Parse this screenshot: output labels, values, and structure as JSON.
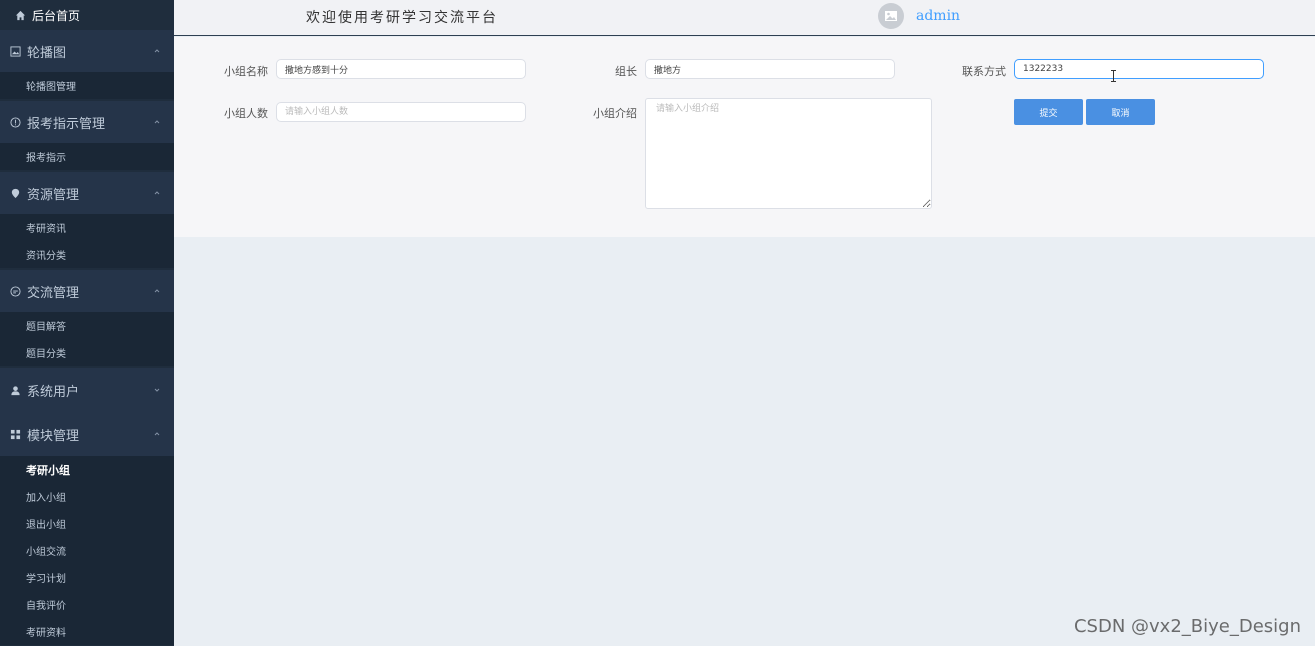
{
  "sidebar": {
    "home_label": "后台首页",
    "groups": [
      {
        "title": "轮播图",
        "icon": "image-icon",
        "expanded": true,
        "items": [
          "轮播图管理"
        ]
      },
      {
        "title": "报考指示管理",
        "icon": "info-icon",
        "expanded": true,
        "items": [
          "报考指示"
        ]
      },
      {
        "title": "资源管理",
        "icon": "location-pin-icon",
        "expanded": true,
        "items": [
          "考研资讯",
          "资讯分类"
        ]
      },
      {
        "title": "交流管理",
        "icon": "chat-icon",
        "expanded": true,
        "items": [
          "题目解答",
          "题目分类"
        ]
      },
      {
        "title": "系统用户",
        "icon": "user-icon",
        "expanded": false,
        "items": []
      },
      {
        "title": "模块管理",
        "icon": "grid-icon",
        "expanded": true,
        "items": [
          "考研小组",
          "加入小组",
          "退出小组",
          "小组交流",
          "学习计划",
          "自我评价",
          "考研资料"
        ],
        "active_item": "考研小组"
      }
    ]
  },
  "header": {
    "title": "欢迎使用考研学习交流平台",
    "user": "admin"
  },
  "form": {
    "group_name": {
      "label": "小组名称",
      "value": "撒地方感到十分"
    },
    "leader": {
      "label": "组长",
      "value": "撒地方"
    },
    "contact": {
      "label": "联系方式",
      "value": "1322233"
    },
    "member_count": {
      "label": "小组人数",
      "placeholder": "请输入小组人数"
    },
    "intro": {
      "label": "小组介绍",
      "placeholder": "请输入小组介绍"
    },
    "submit_label": "提交",
    "cancel_label": "取消"
  },
  "colors": {
    "sidebar_bg": "#1f2d3d",
    "accent": "#409eff",
    "button": "#4a90e2"
  },
  "watermark": "CSDN @vx2_Biye_Design"
}
